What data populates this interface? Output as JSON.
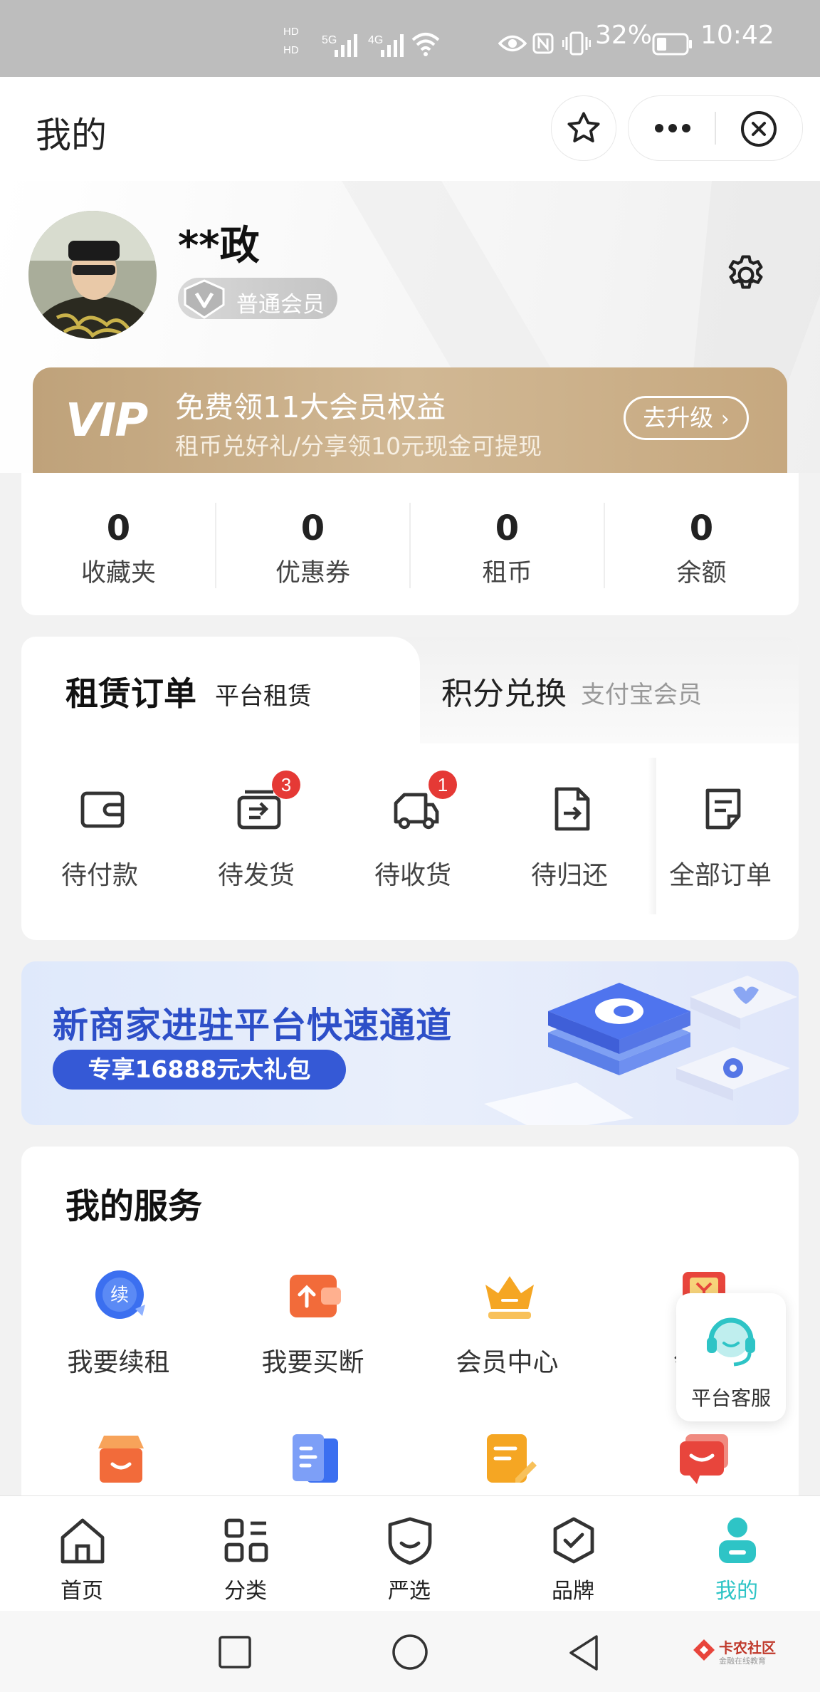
{
  "status_bar": {
    "network_labels": [
      "HD",
      "HD",
      "5G",
      "4G"
    ],
    "battery": "32%",
    "time": "10:42"
  },
  "title_bar": {
    "title": "我的"
  },
  "profile": {
    "name": "**政",
    "member_level": "普通会员"
  },
  "vip_banner": {
    "logo": "VIP",
    "title": "免费领11大会员权益",
    "subtitle": "租币兑好礼/分享领10元现金可提现",
    "button": "去升级"
  },
  "stats": [
    {
      "value": "0",
      "label": "收藏夹"
    },
    {
      "value": "0",
      "label": "优惠券"
    },
    {
      "value": "0",
      "label": "租币"
    },
    {
      "value": "0",
      "label": "余额"
    }
  ],
  "order_tabs": [
    {
      "title": "租赁订单",
      "sub": "平台租赁",
      "active": true
    },
    {
      "title": "积分兑换",
      "sub": "支付宝会员",
      "active": false
    }
  ],
  "orders": [
    {
      "label": "待付款",
      "icon": "wallet-icon",
      "badge": ""
    },
    {
      "label": "待发货",
      "icon": "package-icon",
      "badge": "3"
    },
    {
      "label": "待收货",
      "icon": "truck-icon",
      "badge": "1"
    },
    {
      "label": "待归还",
      "icon": "return-doc-icon",
      "badge": ""
    },
    {
      "label": "全部订单",
      "icon": "all-orders-icon",
      "badge": ""
    }
  ],
  "merchant_banner": {
    "title": "新商家进驻平台快速通道",
    "pill": "专享16888元大礼包"
  },
  "services": {
    "title": "我的服务",
    "row1": [
      {
        "label": "我要续租",
        "icon": "renew-icon",
        "color": "#3b6ff0"
      },
      {
        "label": "我要买断",
        "icon": "buyout-wallet-icon",
        "color": "#f26b3a"
      },
      {
        "label": "会员中心",
        "icon": "crown-icon",
        "color": "#f5a623"
      },
      {
        "label": "领",
        "icon": "coupon-icon",
        "color": "#e8453c"
      }
    ],
    "row2": [
      {
        "icon": "store-icon",
        "color": "#f26b3a"
      },
      {
        "icon": "document-icon",
        "color": "#3b6ff0"
      },
      {
        "icon": "edit-note-icon",
        "color": "#f5a623"
      },
      {
        "icon": "message-icon",
        "color": "#e8453c"
      }
    ]
  },
  "float_service": {
    "label": "平台客服"
  },
  "bottom_nav": [
    {
      "label": "首页",
      "icon": "home-icon",
      "active": false
    },
    {
      "label": "分类",
      "icon": "category-icon",
      "active": false
    },
    {
      "label": "严选",
      "icon": "shield-icon",
      "active": false
    },
    {
      "label": "品牌",
      "icon": "brand-check-icon",
      "active": false
    },
    {
      "label": "我的",
      "icon": "profile-icon",
      "active": true
    }
  ],
  "colors": {
    "accent_teal": "#2ec4c6",
    "badge_red": "#e53935",
    "vip_gold": "#c6a87f"
  },
  "watermark": {
    "text": "卡农社区",
    "sub": "金融在线教育"
  }
}
